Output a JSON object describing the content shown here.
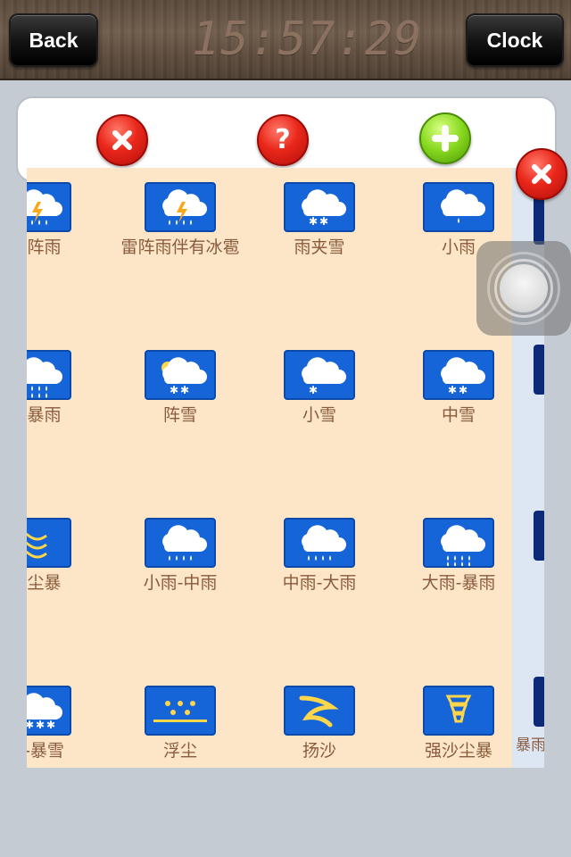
{
  "header": {
    "back_label": "Back",
    "time": "15:57:29",
    "clock_label": "Clock"
  },
  "toolbar": {
    "delete_icon": "close-icon",
    "help_icon": "question-icon",
    "add_icon": "plus-icon",
    "help_glyph": "?"
  },
  "colors": {
    "accent_red": "#e9271b",
    "accent_green": "#86d71e",
    "tile_blue": "#1565d8",
    "panel_bg": "#fde6c8",
    "label_brown": "#8a5a3c"
  },
  "grid": [
    {
      "label": "雷阵雨",
      "icon": "thunder-shower-icon"
    },
    {
      "label": "雷阵雨伴有冰雹",
      "icon": "thunder-hail-icon"
    },
    {
      "label": "雨夹雪",
      "icon": "sleet-icon"
    },
    {
      "label": "小雨",
      "icon": "light-rain-icon"
    },
    {
      "label": "大暴雨",
      "icon": "heavy-storm-icon"
    },
    {
      "label": "阵雪",
      "icon": "snow-shower-icon"
    },
    {
      "label": "小雪",
      "icon": "light-snow-icon"
    },
    {
      "label": "中雪",
      "icon": "moderate-snow-icon"
    },
    {
      "label": "沙尘暴",
      "icon": "sandstorm-icon"
    },
    {
      "label": "小雨-中雨",
      "icon": "light-to-moderate-rain-icon"
    },
    {
      "label": "中雨-大雨",
      "icon": "moderate-to-heavy-rain-icon"
    },
    {
      "label": "大雨-暴雨",
      "icon": "heavy-rain-to-storm-icon"
    },
    {
      "label": "雪-暴雪",
      "icon": "snow-to-blizzard-icon"
    },
    {
      "label": "浮尘",
      "icon": "floating-dust-icon"
    },
    {
      "label": "扬沙",
      "icon": "blowing-sand-icon"
    },
    {
      "label": "强沙尘暴",
      "icon": "severe-sandstorm-icon"
    }
  ],
  "right_strip_label": "暴雨"
}
